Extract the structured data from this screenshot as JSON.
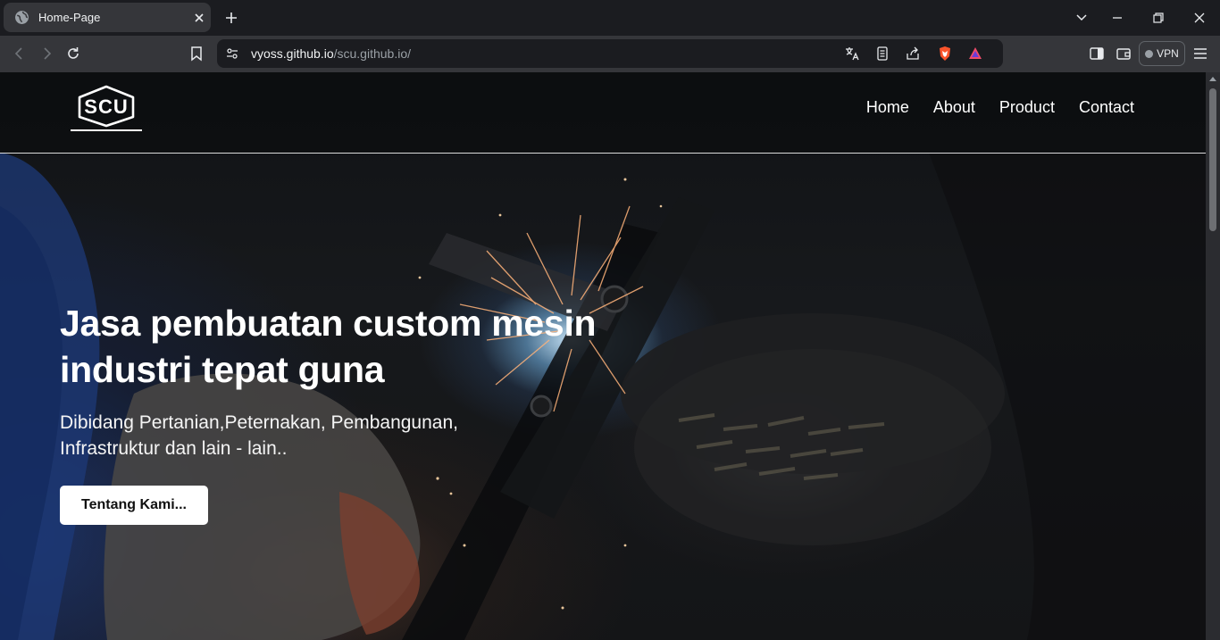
{
  "browser": {
    "tab_title": "Home-Page",
    "url_host": "vyoss.github.io",
    "url_path": "/scu.github.io/",
    "vpn_label": "VPN",
    "icons": [
      "globe-icon",
      "close-icon",
      "plus-icon",
      "chevron-down-icon",
      "minimize-icon",
      "restore-icon",
      "close-window-icon",
      "back-icon",
      "forward-icon",
      "reload-icon",
      "bookmark-icon",
      "site-settings-icon",
      "translate-icon",
      "reader-mode-icon",
      "share-icon",
      "brave-shields-icon",
      "brave-rewards-icon",
      "sidebar-icon",
      "wallet-icon",
      "menu-icon"
    ]
  },
  "site": {
    "logo_text": "SCU",
    "nav": [
      "Home",
      "About",
      "Product",
      "Contact"
    ],
    "hero": {
      "title": "Jasa pembuatan custom mesin industri tepat guna",
      "subtitle": "Dibidang Pertanian,Peternakan, Pembangunan, Infrastruktur dan lain - lain..",
      "cta_label": "Tentang Kami..."
    }
  },
  "colors": {
    "chrome_dark": "#1b1c20",
    "chrome_mid": "#35363a",
    "brave_orange": "#fb542b",
    "cta_bg": "#ffffff"
  }
}
